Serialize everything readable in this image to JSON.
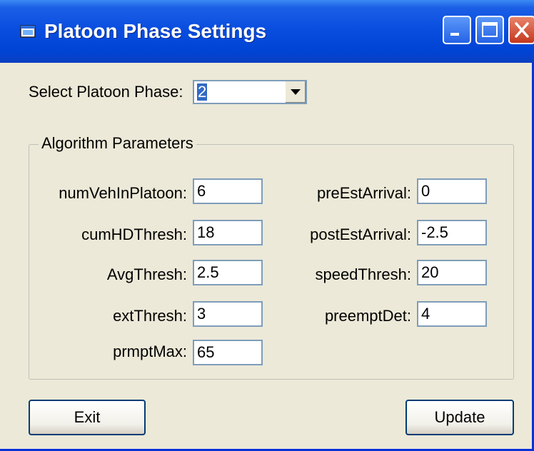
{
  "window": {
    "title": "Platoon Phase Settings",
    "icon": "app-window-icon",
    "controls": [
      "minimize-icon",
      "maximize-icon",
      "close-icon"
    ],
    "accent": "#0a4ee0",
    "close_color": "#c5381e",
    "face_color": "#ece9d8"
  },
  "phase": {
    "label": "Select Platoon Phase:",
    "value": "2"
  },
  "group": {
    "title": "Algorithm Parameters"
  },
  "params": {
    "numVehInPlatoon": {
      "label": "numVehInPlatoon:",
      "value": "6"
    },
    "cumHDThresh": {
      "label": "cumHDThresh:",
      "value": "18"
    },
    "AvgThresh": {
      "label": "AvgThresh:",
      "value": "2.5"
    },
    "extThresh": {
      "label": "extThresh:",
      "value": "3"
    },
    "prmptMax": {
      "label": "prmptMax:",
      "value": "65"
    },
    "preEstArrival": {
      "label": "preEstArrival:",
      "value": "0"
    },
    "postEstArrival": {
      "label": "postEstArrival:",
      "value": "-2.5"
    },
    "speedThresh": {
      "label": "speedThresh:",
      "value": "20"
    },
    "preemptDet": {
      "label": "preemptDet:",
      "value": "4"
    }
  },
  "buttons": {
    "exit": "Exit",
    "update": "Update"
  }
}
